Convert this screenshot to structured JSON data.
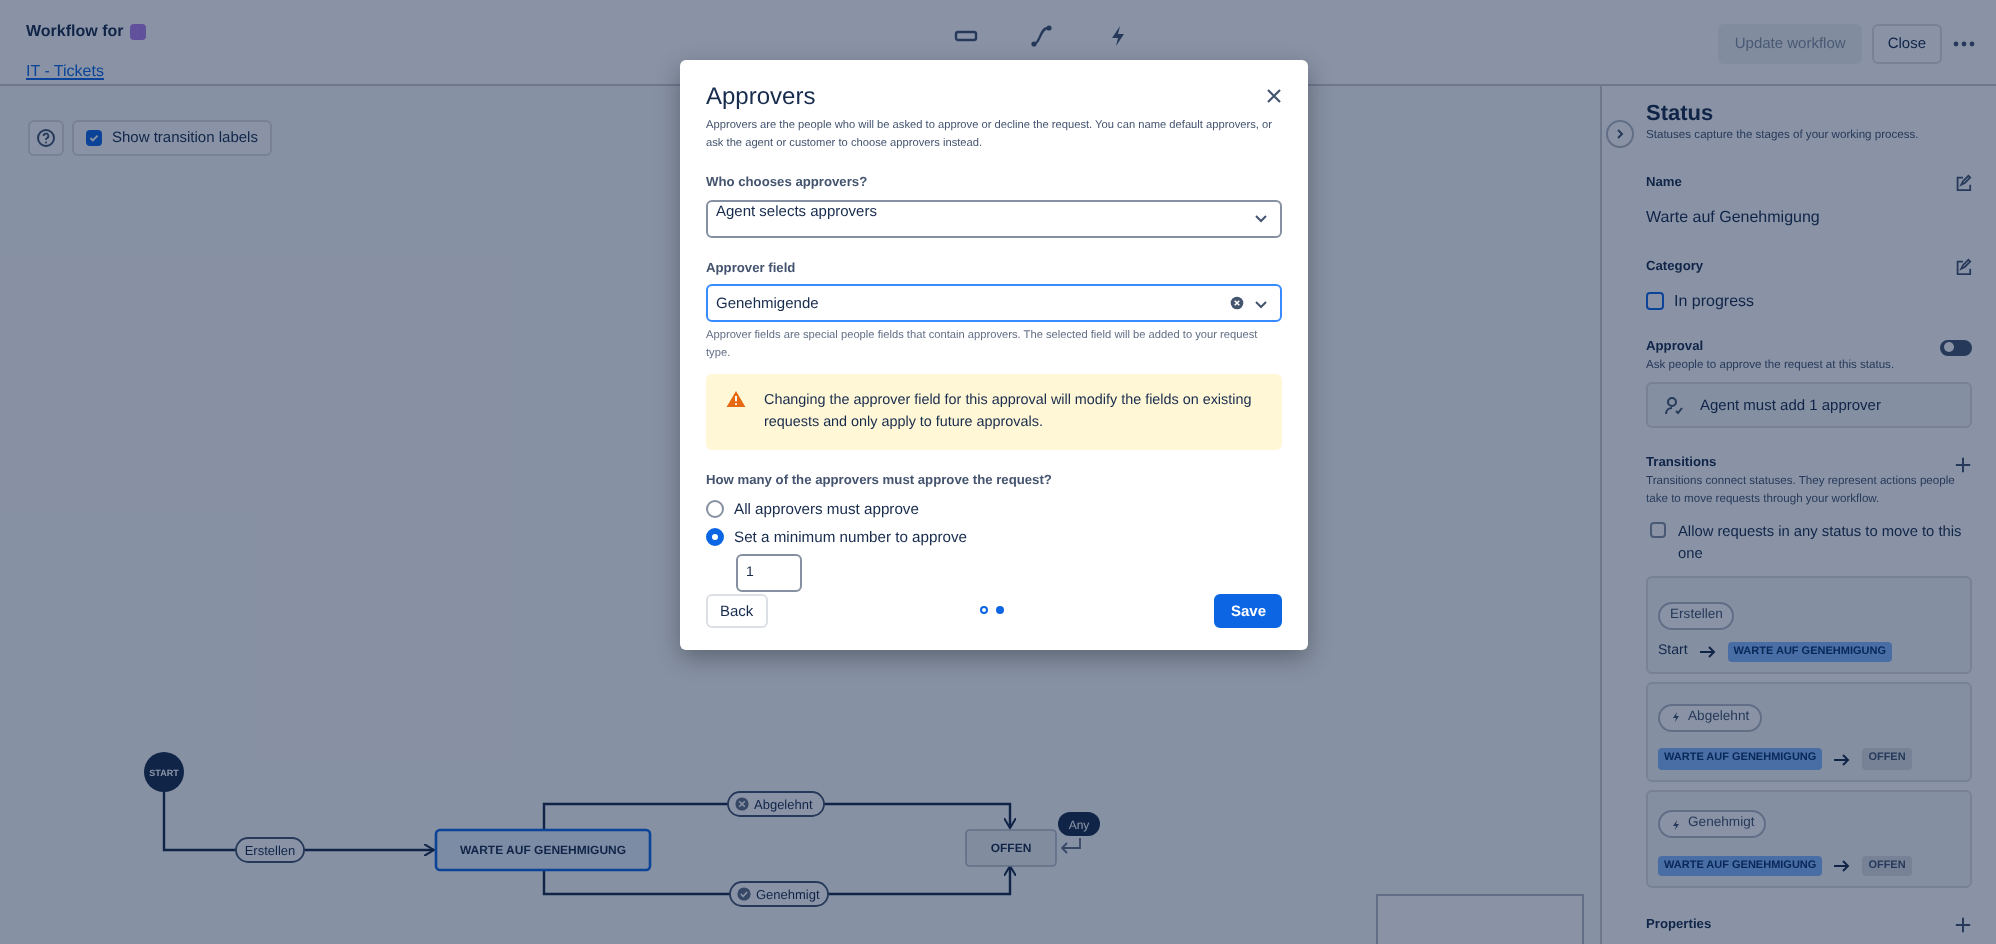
{
  "header": {
    "title": "Workflow for",
    "project_link": "IT - Tickets",
    "update_button": "Update workflow",
    "close_button": "Close"
  },
  "toolbar": {
    "show_labels": {
      "label": "Show transition labels",
      "checked": true
    }
  },
  "diagram": {
    "start_label": "START",
    "any_badge": "Any",
    "nodes": [
      {
        "label": "WARTE AUF GENEHMIGUNG",
        "selected": true
      },
      {
        "label": "OFFEN",
        "selected": false
      }
    ],
    "transitions": [
      {
        "label": "Erstellen",
        "kind": "plain"
      },
      {
        "label": "Abgelehnt",
        "kind": "rejected"
      },
      {
        "label": "Genehmigt",
        "kind": "approved"
      }
    ]
  },
  "panel": {
    "title": "Status",
    "subtitle": "Statuses capture the stages of your working process.",
    "name_label": "Name",
    "name_value": "Warte auf Genehmigung",
    "category_label": "Category",
    "category": {
      "label": "In progress",
      "checked": false
    },
    "approval_label": "Approval",
    "approval_toggle": {
      "on": false
    },
    "approval_help": "Ask people to approve the request at this status.",
    "approver_button": "Agent must add 1 approver",
    "transitions_label": "Transitions",
    "transitions_help": "Transitions connect statuses. They represent actions people take to move requests through your workflow.",
    "allow_any": {
      "label": "Allow requests in any status to move to this one",
      "checked": false
    },
    "transition_cards": [
      {
        "name": "Erstellen",
        "kind": "initial",
        "from": {
          "text": "Start",
          "kind": "plain"
        },
        "to": {
          "text": "WARTE AUF GENEHMIGUNG",
          "kind": "inprogress"
        }
      },
      {
        "name": "Abgelehnt",
        "kind": "rule",
        "from": {
          "text": "WARTE AUF GENEHMIGUNG",
          "kind": "inprogress"
        },
        "to": {
          "text": "OFFEN",
          "kind": "todo"
        }
      },
      {
        "name": "Genehmigt",
        "kind": "rule",
        "from": {
          "text": "WARTE AUF GENEHMIGUNG",
          "kind": "inprogress"
        },
        "to": {
          "text": "OFFEN",
          "kind": "todo"
        }
      }
    ],
    "properties_label": "Properties"
  },
  "modal": {
    "title": "Approvers",
    "description": "Approvers are the people who will be asked to approve or decline the request. You can name default approvers, or ask the agent or customer to choose approvers instead.",
    "who_label": "Who chooses approvers?",
    "who_value": "Agent selects approvers",
    "field_label": "Approver field",
    "field_value": "Genehmigende",
    "field_help": "Approver fields are special people fields that contain approvers. The selected field will be added to your request type.",
    "warning": "Changing the approver field for this approval will modify the fields on existing requests and only apply to future approvals.",
    "question": "How many of the approvers must approve the request?",
    "options": [
      {
        "label": "All approvers must approve",
        "selected": false
      },
      {
        "label": "Set a minimum number to approve",
        "selected": true
      }
    ],
    "min_value": "1",
    "steps": [
      {
        "selected": false
      },
      {
        "selected": true
      }
    ],
    "back_button": "Back",
    "save_button": "Save"
  }
}
